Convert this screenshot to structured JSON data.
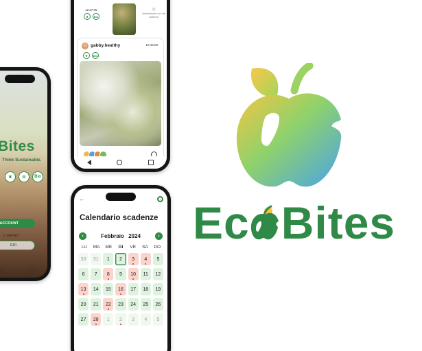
{
  "brand": {
    "name_left": "Ec",
    "name_right": "Bites",
    "colors": {
      "primary_green": "#2f8a47",
      "gradient_start": "#f4c542",
      "gradient_mid": "#7fd07a",
      "gradient_end": "#4aa3e8"
    }
  },
  "login_screen": {
    "title": "EcBites",
    "title_visible": "Bites",
    "tagline": "Think Sustainable.",
    "badges": [
      "leaf-icon",
      "eco-icon",
      "Bio"
    ],
    "account_button": "ACCOUNT",
    "question": "n utente?",
    "secondary_button": "EDI"
  },
  "feed_screen": {
    "prev_post": {
      "time": "12:27:05",
      "badges": [
        "leaf-icon",
        "Bio"
      ],
      "notif_text": "Attualmente non hai notifiche"
    },
    "post": {
      "user": "gabby.healthy",
      "time": "12:48:09",
      "badges": [
        "leaf-icon",
        "Bio"
      ]
    }
  },
  "calendar_screen": {
    "title": "Calendario scadenze",
    "month": "Febbraio",
    "year": "2024",
    "weekdays": [
      "LU",
      "MA",
      "ME",
      "GI",
      "VE",
      "SA",
      "DO"
    ],
    "active_weekday": "GI",
    "days": [
      {
        "d": "30",
        "state": "other"
      },
      {
        "d": "31",
        "state": "other"
      },
      {
        "d": "1",
        "state": "normal"
      },
      {
        "d": "2",
        "state": "today"
      },
      {
        "d": "3",
        "state": "alert",
        "dot": true
      },
      {
        "d": "4",
        "state": "alert",
        "dot": true
      },
      {
        "d": "5",
        "state": "normal"
      },
      {
        "d": "6",
        "state": "normal"
      },
      {
        "d": "7",
        "state": "normal"
      },
      {
        "d": "8",
        "state": "alert",
        "dot": true
      },
      {
        "d": "9",
        "state": "normal"
      },
      {
        "d": "10",
        "state": "alert",
        "dot": true
      },
      {
        "d": "11",
        "state": "normal"
      },
      {
        "d": "12",
        "state": "normal"
      },
      {
        "d": "13",
        "state": "alert",
        "dot": true
      },
      {
        "d": "14",
        "state": "normal"
      },
      {
        "d": "15",
        "state": "normal"
      },
      {
        "d": "16",
        "state": "alert",
        "dot": true
      },
      {
        "d": "17",
        "state": "normal"
      },
      {
        "d": "18",
        "state": "normal"
      },
      {
        "d": "19",
        "state": "normal"
      },
      {
        "d": "20",
        "state": "normal"
      },
      {
        "d": "21",
        "state": "normal"
      },
      {
        "d": "22",
        "state": "alert",
        "dot": true
      },
      {
        "d": "23",
        "state": "normal"
      },
      {
        "d": "24",
        "state": "normal"
      },
      {
        "d": "25",
        "state": "normal"
      },
      {
        "d": "26",
        "state": "normal"
      },
      {
        "d": "27",
        "state": "normal"
      },
      {
        "d": "28",
        "state": "alert",
        "dot": true
      },
      {
        "d": "1",
        "state": "other"
      },
      {
        "d": "2",
        "state": "other",
        "dot": true
      },
      {
        "d": "3",
        "state": "other"
      },
      {
        "d": "4",
        "state": "other"
      },
      {
        "d": "5",
        "state": "other"
      }
    ]
  }
}
